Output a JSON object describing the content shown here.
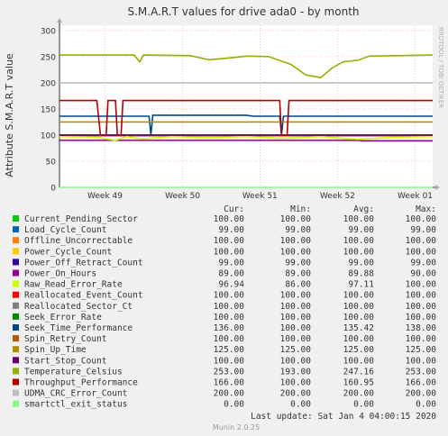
{
  "chart_data": {
    "type": "line",
    "title": "S.M.A.R.T values for drive ada0 - by month",
    "ylabel": "Attribute S.M.A.R.T value",
    "ylim": [
      0,
      310
    ],
    "yticks": [
      0,
      50,
      100,
      150,
      200,
      250,
      300
    ],
    "xlim": [
      0,
      1
    ],
    "xticks": [
      {
        "label": "Week 49",
        "x": 0.122
      },
      {
        "label": "Week 50",
        "x": 0.33
      },
      {
        "label": "Week 51",
        "x": 0.537
      },
      {
        "label": "Week 52",
        "x": 0.745
      },
      {
        "label": "Week 01",
        "x": 0.953
      }
    ],
    "grid": true,
    "side_label": "RRDTOOL / TOBI OETIKER",
    "legend_headers": [
      "Cur:",
      "Min:",
      "Avg:",
      "Max:"
    ],
    "series": [
      {
        "name": "Current_Pending_Sector",
        "color": "#00cc00",
        "cur": "100.00",
        "min": "100.00",
        "avg": "100.00",
        "max": "100.00",
        "points": [
          [
            0,
            100
          ],
          [
            1,
            100
          ]
        ]
      },
      {
        "name": "Load_Cycle_Count",
        "color": "#0066b3",
        "cur": "99.00",
        "min": "99.00",
        "avg": "99.00",
        "max": "99.00",
        "points": [
          [
            0,
            99
          ],
          [
            1,
            99
          ]
        ]
      },
      {
        "name": "Offline_Uncorrectable",
        "color": "#ff8000",
        "cur": "100.00",
        "min": "100.00",
        "avg": "100.00",
        "max": "100.00",
        "points": [
          [
            0,
            100
          ],
          [
            1,
            100
          ]
        ]
      },
      {
        "name": "Power_Cycle_Count",
        "color": "#ffcc00",
        "cur": "100.00",
        "min": "100.00",
        "avg": "100.00",
        "max": "100.00",
        "points": [
          [
            0,
            100
          ],
          [
            1,
            100
          ]
        ]
      },
      {
        "name": "Power_Off_Retract_Count",
        "color": "#330099",
        "cur": "99.00",
        "min": "99.00",
        "avg": "99.00",
        "max": "99.00",
        "points": [
          [
            0,
            99
          ],
          [
            1,
            99
          ]
        ]
      },
      {
        "name": "Power_On_Hours",
        "color": "#990099",
        "cur": "89.00",
        "min": "89.00",
        "avg": "89.88",
        "max": "90.00",
        "points": [
          [
            0,
            90
          ],
          [
            0.8,
            90
          ],
          [
            0.81,
            89
          ],
          [
            1,
            89
          ]
        ]
      },
      {
        "name": "Raw_Read_Error_Rate",
        "color": "#ccff00",
        "cur": "96.94",
        "min": "86.00",
        "avg": "97.11",
        "max": "100.00",
        "points": [
          [
            0,
            97
          ],
          [
            0.1,
            96
          ],
          [
            0.15,
            90
          ],
          [
            0.18,
            97
          ],
          [
            0.22,
            93
          ],
          [
            0.3,
            97
          ],
          [
            0.4,
            95
          ],
          [
            0.5,
            97
          ],
          [
            0.6,
            94
          ],
          [
            0.7,
            97
          ],
          [
            0.8,
            92
          ],
          [
            0.9,
            96
          ],
          [
            1,
            97
          ]
        ]
      },
      {
        "name": "Reallocated_Event_Count",
        "color": "#ff0000",
        "cur": "100.00",
        "min": "100.00",
        "avg": "100.00",
        "max": "100.00",
        "points": [
          [
            0,
            100
          ],
          [
            1,
            100
          ]
        ]
      },
      {
        "name": "Reallocated_Sector_Ct",
        "color": "#808080",
        "cur": "100.00",
        "min": "100.00",
        "avg": "100.00",
        "max": "100.00",
        "points": [
          [
            0,
            100
          ],
          [
            1,
            100
          ]
        ]
      },
      {
        "name": "Seek_Error_Rate",
        "color": "#008f00",
        "cur": "100.00",
        "min": "100.00",
        "avg": "100.00",
        "max": "100.00",
        "points": [
          [
            0,
            100
          ],
          [
            1,
            100
          ]
        ]
      },
      {
        "name": "Seek_Time_Performance",
        "color": "#00487d",
        "cur": "136.00",
        "min": "100.00",
        "avg": "135.42",
        "max": "138.00",
        "points": [
          [
            0,
            136
          ],
          [
            0.24,
            136
          ],
          [
            0.245,
            100
          ],
          [
            0.25,
            138
          ],
          [
            0.5,
            138
          ],
          [
            0.52,
            136
          ],
          [
            0.59,
            136
          ],
          [
            0.595,
            100
          ],
          [
            0.6,
            136
          ],
          [
            1,
            136
          ]
        ]
      },
      {
        "name": "Spin_Retry_Count",
        "color": "#b35a00",
        "cur": "100.00",
        "min": "100.00",
        "avg": "100.00",
        "max": "100.00",
        "points": [
          [
            0,
            100
          ],
          [
            1,
            100
          ]
        ]
      },
      {
        "name": "Spin_Up_Time",
        "color": "#b38f00",
        "cur": "125.00",
        "min": "125.00",
        "avg": "125.00",
        "max": "125.00",
        "points": [
          [
            0,
            125
          ],
          [
            1,
            125
          ]
        ]
      },
      {
        "name": "Start_Stop_Count",
        "color": "#6b006b",
        "cur": "100.00",
        "min": "100.00",
        "avg": "100.00",
        "max": "100.00",
        "points": [
          [
            0,
            100
          ],
          [
            1,
            100
          ]
        ]
      },
      {
        "name": "Temperature_Celsius",
        "color": "#8fb300",
        "cur": "253.00",
        "min": "193.00",
        "avg": "247.16",
        "max": "253.00",
        "points": [
          [
            0,
            253
          ],
          [
            0.2,
            253
          ],
          [
            0.215,
            240
          ],
          [
            0.225,
            253
          ],
          [
            0.35,
            252
          ],
          [
            0.4,
            244
          ],
          [
            0.45,
            247
          ],
          [
            0.5,
            251
          ],
          [
            0.56,
            250
          ],
          [
            0.62,
            235
          ],
          [
            0.66,
            215
          ],
          [
            0.7,
            210
          ],
          [
            0.73,
            228
          ],
          [
            0.76,
            240
          ],
          [
            0.8,
            243
          ],
          [
            0.83,
            251
          ],
          [
            1,
            253
          ]
        ]
      },
      {
        "name": "Throughput_Performance",
        "color": "#b30000",
        "cur": "166.00",
        "min": "100.00",
        "avg": "160.95",
        "max": "166.00",
        "points": [
          [
            0,
            166
          ],
          [
            0.1,
            166
          ],
          [
            0.11,
            100
          ],
          [
            0.125,
            100
          ],
          [
            0.13,
            166
          ],
          [
            0.15,
            166
          ],
          [
            0.155,
            100
          ],
          [
            0.165,
            100
          ],
          [
            0.17,
            166
          ],
          [
            0.59,
            166
          ],
          [
            0.595,
            100
          ],
          [
            0.61,
            100
          ],
          [
            0.615,
            166
          ],
          [
            1,
            166
          ]
        ]
      },
      {
        "name": "UDMA_CRC_Error_Count",
        "color": "#bebebe",
        "cur": "200.00",
        "min": "200.00",
        "avg": "200.00",
        "max": "200.00",
        "points": [
          [
            0,
            200
          ],
          [
            1,
            200
          ]
        ]
      },
      {
        "name": "smartctl_exit_status",
        "color": "#80ff80",
        "cur": "0.00",
        "min": "0.00",
        "avg": "0.00",
        "max": "0.00",
        "points": [
          [
            0,
            0
          ],
          [
            1,
            0
          ]
        ]
      }
    ]
  },
  "footer": {
    "last_update": "Last update:  Sat Jan  4 04:00:15 2020",
    "version": "Munin 2.0.25"
  }
}
